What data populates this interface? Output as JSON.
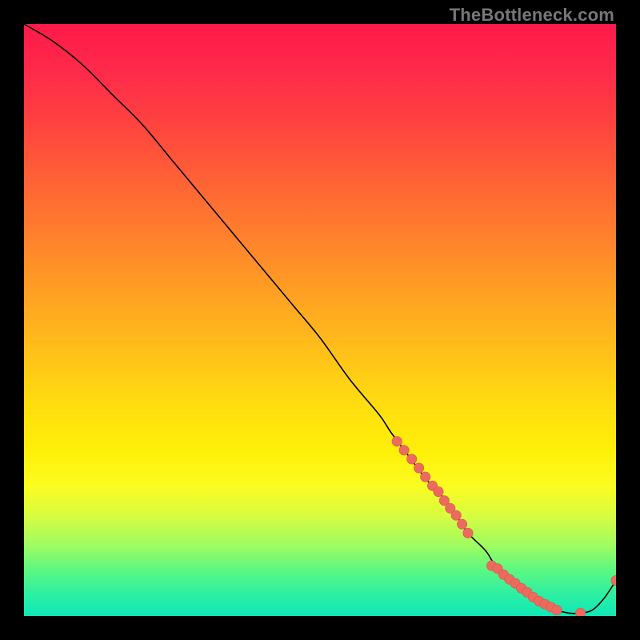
{
  "watermark": "TheBottleneck.com",
  "colors": {
    "curve": "#000000",
    "marker_fill": "#ec6a5e",
    "marker_stroke": "#d4584d"
  },
  "chart_data": {
    "type": "line",
    "title": "",
    "xlabel": "",
    "ylabel": "",
    "xlim": [
      0,
      100
    ],
    "ylim": [
      0,
      100
    ],
    "grid": false,
    "legend": false,
    "series": [
      {
        "name": "curve",
        "style": "line",
        "x": [
          0,
          5,
          10,
          15,
          20,
          25,
          30,
          35,
          40,
          45,
          50,
          55,
          60,
          62,
          65,
          68,
          70,
          73,
          75,
          78,
          80,
          83,
          85,
          88,
          90,
          92,
          94,
          96,
          98,
          100
        ],
        "values": [
          100,
          97,
          93,
          88,
          83,
          77,
          71,
          65,
          59,
          53,
          47,
          40,
          34,
          31,
          27,
          23,
          21,
          17,
          14,
          11,
          8,
          6,
          4,
          2,
          1,
          0.5,
          0.5,
          1,
          3,
          6
        ]
      },
      {
        "name": "markers",
        "style": "scatter",
        "x": [
          63.0,
          64.2,
          65.5,
          66.7,
          67.8,
          69.0,
          70.0,
          71.0,
          72.0,
          73.0,
          74.0,
          75.0,
          79.0,
          80.0,
          81.0,
          82.0,
          83.0,
          84.0,
          85.0,
          86.0,
          87.0,
          88.0,
          89.0,
          90.0,
          94.0,
          100.0
        ],
        "values": [
          29.5,
          28.0,
          26.5,
          25.0,
          23.5,
          22.0,
          21.0,
          19.5,
          18.2,
          17.0,
          15.5,
          14.0,
          8.5,
          8.0,
          7.0,
          6.2,
          5.5,
          4.7,
          4.0,
          3.2,
          2.5,
          2.0,
          1.5,
          1.0,
          0.5,
          6.0
        ]
      }
    ]
  }
}
